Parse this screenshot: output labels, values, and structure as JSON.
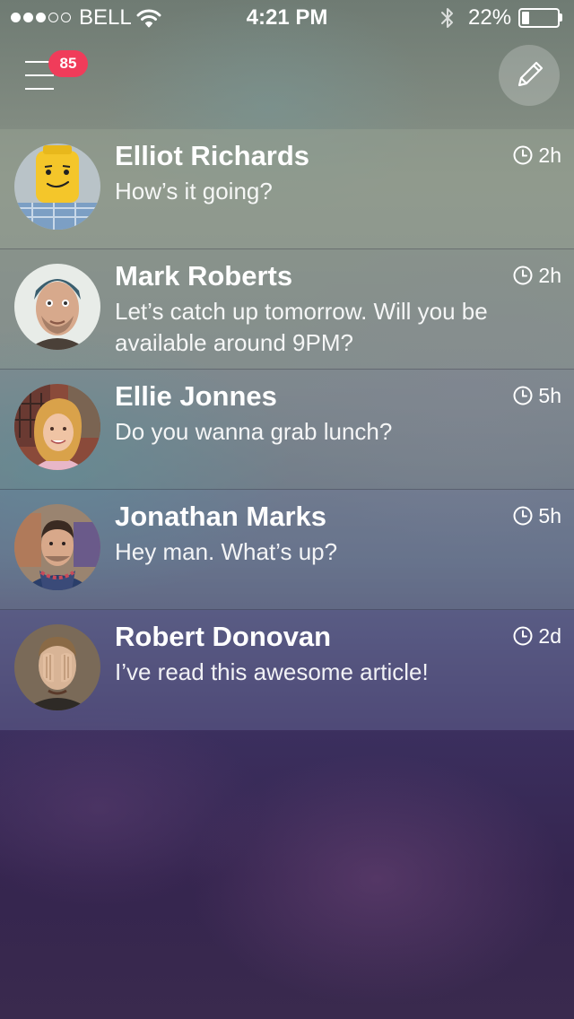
{
  "status_bar": {
    "carrier": "BELL",
    "time": "4:21 PM",
    "battery": "22%",
    "battery_level": 0.22,
    "signal_bars_filled": 3,
    "signal_bars_total": 5
  },
  "header": {
    "unread_badge": "85"
  },
  "icons": {
    "menu": "hamburger-menu-icon",
    "compose": "pencil-icon",
    "time": "clock-icon"
  },
  "colors": {
    "badge": "#f03c5a"
  },
  "messages": [
    {
      "name": "Elliot Richards",
      "preview": "How’s it going?",
      "time": "2h",
      "row_bg": "rgba(150,160,145,0.55)"
    },
    {
      "name": "Mark Roberts",
      "preview": "Let’s catch up tomorrow. Will you be available around 9PM?",
      "time": "2h",
      "row_bg": "rgba(140,150,140,0.45)"
    },
    {
      "name": "Ellie Jonnes",
      "preview": "Do you wanna grab lunch?",
      "time": "5h",
      "row_bg": "rgba(130,140,140,0.38)"
    },
    {
      "name": "Jonathan Marks",
      "preview": "Hey man. What’s up?",
      "time": "5h",
      "row_bg": "rgba(120,130,150,0.40)"
    },
    {
      "name": "Robert Donovan",
      "preview": "I’ve read this awesome article!",
      "time": "2d",
      "row_bg": "rgba(95,95,140,0.55)"
    }
  ]
}
